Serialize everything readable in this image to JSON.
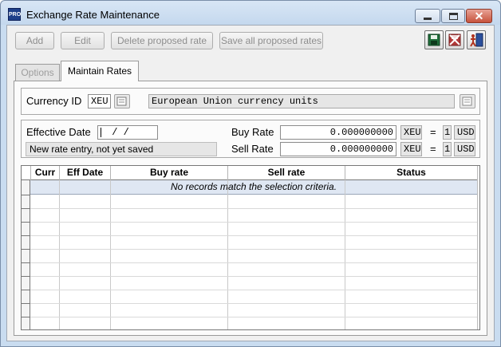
{
  "window": {
    "title": "Exchange Rate Maintenance",
    "app_icon_text": "PRO"
  },
  "toolbar": {
    "add_label": "Add",
    "edit_label": "Edit",
    "delete_label": "Delete proposed rate",
    "save_all_label": "Save all proposed rates",
    "icons": [
      "save-icon",
      "cancel-icon",
      "exit-icon"
    ]
  },
  "tabs": [
    {
      "label": "Options",
      "enabled": false
    },
    {
      "label": "Maintain Rates",
      "selected": true
    }
  ],
  "currency": {
    "label": "Currency ID",
    "id": "XEU",
    "description": "European Union currency units"
  },
  "rate_entry": {
    "effective_date_label": "Effective Date",
    "effective_date_value": " /  /",
    "status_message": "New rate entry, not yet saved",
    "buy_rate_label": "Buy Rate",
    "buy_rate_value": "0.000000000",
    "buy_from_currency": "XEU",
    "buy_equals": "=",
    "buy_units": "1",
    "buy_to_currency": "USD",
    "sell_rate_label": "Sell Rate",
    "sell_rate_value": "0.000000000",
    "sell_from_currency": "XEU",
    "sell_equals": "=",
    "sell_units": "1",
    "sell_to_currency": "USD"
  },
  "grid": {
    "columns": [
      "Curr",
      "Eff Date",
      "Buy rate",
      "Sell rate",
      "Status"
    ],
    "empty_message": "No records match the selection criteria."
  },
  "colors": {
    "window_frame": "#c9dcf0",
    "selection_row": "#dfe7f3",
    "close_button": "#c7523c"
  }
}
